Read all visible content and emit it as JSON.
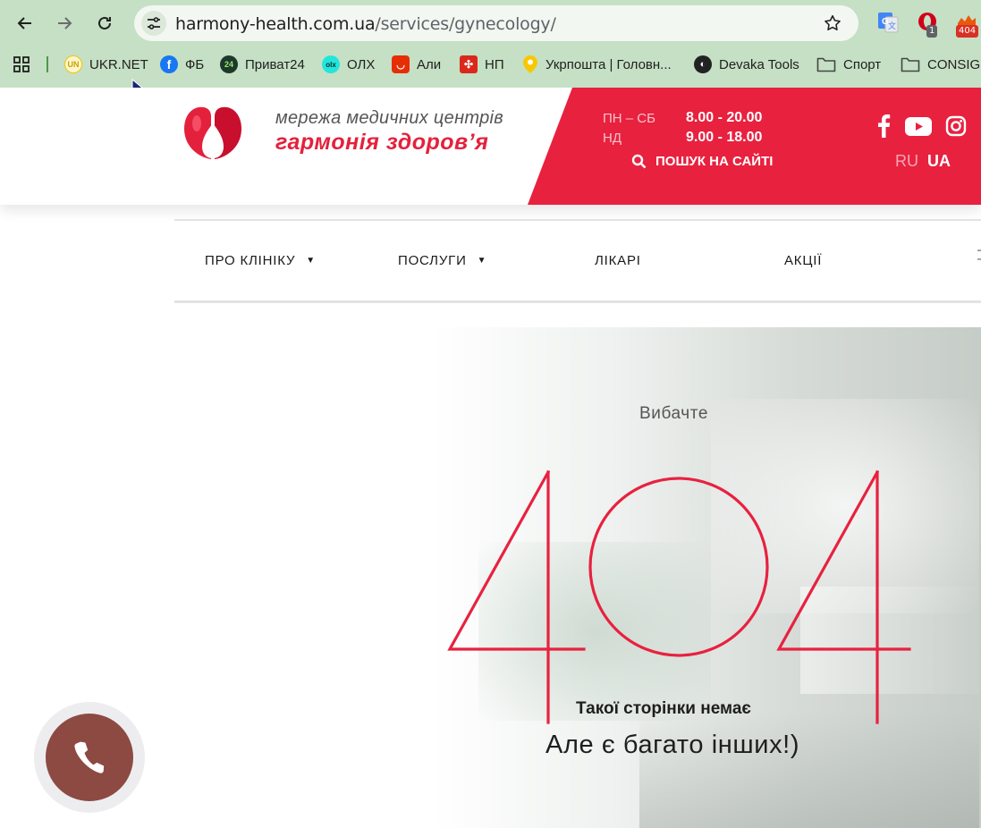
{
  "browser": {
    "url_host": "harmony-health.com.ua",
    "url_path": "/services/gynecology/",
    "extensions": [
      {
        "name": "google-translate",
        "badge": ""
      },
      {
        "name": "opera-extension",
        "badge": "1"
      },
      {
        "name": "broken-links-checker",
        "badge": "404"
      }
    ],
    "bookmarks": [
      {
        "label": "UKR.NET",
        "icon": "ukrnet-icon",
        "color": "#f1c40f"
      },
      {
        "label": "ФБ",
        "icon": "facebook-icon",
        "color": "#1877f2"
      },
      {
        "label": "Приват24",
        "icon": "privat24-icon",
        "color": "#1b3a2a"
      },
      {
        "label": "ОЛХ",
        "icon": "olx-icon",
        "color": "#23e5db"
      },
      {
        "label": "Али",
        "icon": "aliexpress-icon",
        "color": "#e62e04"
      },
      {
        "label": "НП",
        "icon": "novaposhta-icon",
        "color": "#da291c"
      },
      {
        "label": "Укрпошта | Головн...",
        "icon": "ukrposhta-icon",
        "color": "#f9c700"
      },
      {
        "label": "Devaka Tools",
        "icon": "devaka-icon",
        "color": "#222222"
      },
      {
        "label": "Спорт",
        "icon": "folder-icon",
        "color": "#444444"
      },
      {
        "label": "CONSIGL",
        "icon": "folder-icon",
        "color": "#444444"
      }
    ]
  },
  "site": {
    "logo_line1": "мережа медичних центрів",
    "logo_line2": "гармонія здоров’я",
    "hours": [
      {
        "days": "ПН – СБ",
        "time": "8.00 - 20.00"
      },
      {
        "days": "НД",
        "time": "9.00 - 18.00"
      }
    ],
    "search_label": "ПОШУК НА САЙТІ",
    "social": [
      "facebook-icon",
      "youtube-icon",
      "instagram-icon"
    ],
    "lang_ru": "RU",
    "lang_ua": "UA",
    "nav": [
      {
        "label": "ПРО КЛІНІКУ",
        "dropdown": true
      },
      {
        "label": "ПОСЛУГИ",
        "dropdown": true
      },
      {
        "label": "ЛІКАРІ",
        "dropdown": false
      },
      {
        "label": "АКЦІЇ",
        "dropdown": false
      }
    ],
    "nav_clipped": [
      "Н",
      "П"
    ],
    "brand_red": "#e8213f"
  },
  "error": {
    "sorry": "Вибачте",
    "code": "404",
    "message": "Такої сторінки немає",
    "sub_message": "Але є багато інших!)"
  },
  "call_button": {
    "icon": "phone-icon",
    "color": "#8d4a42"
  }
}
